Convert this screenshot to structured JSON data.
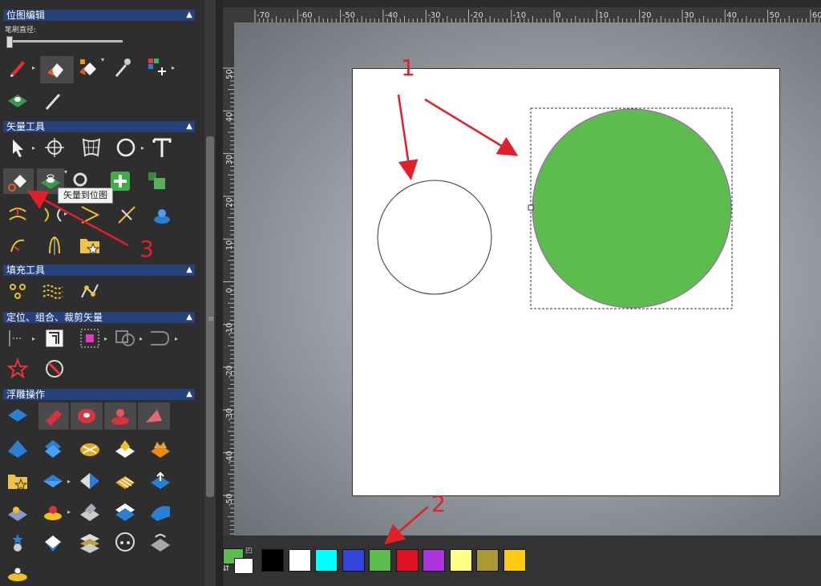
{
  "sections": {
    "bitmap_edit": "位图编辑",
    "brush_diameter_label": "笔刷直径:",
    "vector_tools": "矢量工具",
    "fill_tools": "填充工具",
    "position_group_clip": "定位、组合、裁剪矢量",
    "relief_ops": "浮雕操作"
  },
  "tooltip": "矢量到位图",
  "annotations": [
    "1",
    "2",
    "3"
  ],
  "ruler": {
    "x_ticks": [
      "-70",
      "-60",
      "-50",
      "-40",
      "-30",
      "-20",
      "-10",
      "0",
      "10",
      "20",
      "30",
      "40",
      "50",
      "60"
    ],
    "y_ticks": [
      "50",
      "40",
      "30",
      "20",
      "10",
      "0",
      "-10",
      "-20",
      "-30",
      "-40",
      "-50"
    ]
  },
  "palette": {
    "primary": "#5cbc4e",
    "secondary": "#ffffff",
    "swatches": [
      "#000000",
      "#ffffff",
      "#00ffff",
      "#3344dd",
      "#5cbc4e",
      "#dd1122",
      "#aa33dd",
      "#ffff88",
      "#aa9933",
      "#ffcc11"
    ]
  },
  "colors": {
    "accent_header": "#27417a",
    "annotation": "#e0202a",
    "green_circle": "#5cbc4e"
  }
}
